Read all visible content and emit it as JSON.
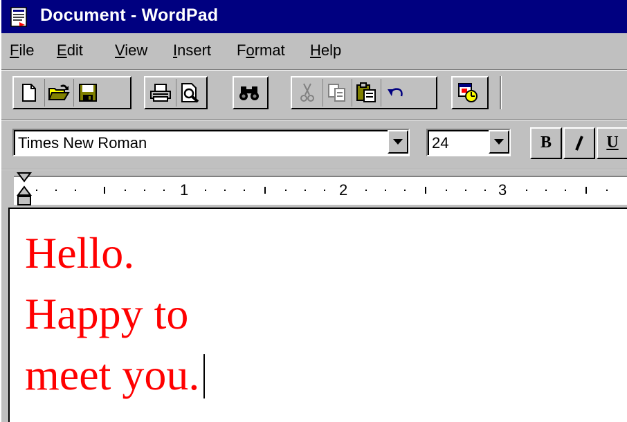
{
  "window": {
    "title": "Document - WordPad"
  },
  "menu": {
    "items": [
      {
        "label_pre": "",
        "label_ul": "F",
        "label_post": "ile"
      },
      {
        "label_pre": "",
        "label_ul": "E",
        "label_post": "dit"
      },
      {
        "label_pre": "",
        "label_ul": "V",
        "label_post": "iew"
      },
      {
        "label_pre": "",
        "label_ul": "I",
        "label_post": "nsert"
      },
      {
        "label_pre": "F",
        "label_ul": "o",
        "label_post": "rmat"
      },
      {
        "label_pre": "",
        "label_ul": "H",
        "label_post": "elp"
      }
    ]
  },
  "toolbar": {
    "buttons": [
      "new-icon",
      "open-icon",
      "save-icon",
      "print-icon",
      "print-preview-icon",
      "find-icon",
      "cut-icon",
      "copy-icon",
      "paste-icon",
      "undo-icon",
      "date-time-icon"
    ]
  },
  "format_bar": {
    "font_name": "Times New Roman",
    "font_size": "24",
    "bold_label": "B",
    "italic_label": "I",
    "underline_label": "U"
  },
  "ruler": {
    "numbers": [
      "1",
      "2",
      "3"
    ]
  },
  "document": {
    "lines": [
      "Hello.",
      "Happy to",
      "meet you."
    ],
    "text_color": "#ff0000"
  },
  "colors": {
    "titlebar": "#000080",
    "face": "#c0c0c0"
  }
}
